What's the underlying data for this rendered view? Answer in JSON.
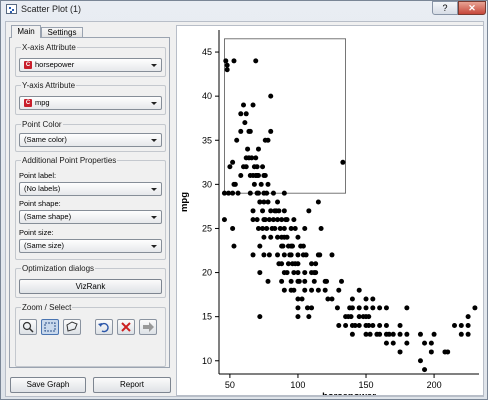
{
  "window": {
    "title": "Scatter Plot (1)",
    "help": "?",
    "close": "✕"
  },
  "tabs": [
    {
      "label": "Main"
    },
    {
      "label": "Settings"
    }
  ],
  "x_attr": {
    "label": "X-axis Attribute",
    "badge": "C",
    "value": "horsepower"
  },
  "y_attr": {
    "label": "Y-axis Attribute",
    "badge": "C",
    "value": "mpg"
  },
  "point_color": {
    "label": "Point Color",
    "value": "(Same color)"
  },
  "additional": {
    "label": "Additional Point Properties",
    "point_label": {
      "label": "Point label:",
      "value": "(No labels)"
    },
    "point_shape": {
      "label": "Point shape:",
      "value": "(Same shape)"
    },
    "point_size": {
      "label": "Point size:",
      "value": "(Same size)"
    }
  },
  "optimization": {
    "label": "Optimization dialogs",
    "button": "VizRank"
  },
  "zoom": {
    "label": "Zoom / Select"
  },
  "footer": {
    "save": "Save Graph",
    "report": "Report"
  },
  "chart_data": {
    "type": "scatter",
    "xlabel": "horsepower",
    "ylabel": "mpg",
    "xlim": [
      42,
      233
    ],
    "ylim": [
      8.5,
      47.5
    ],
    "xticks": [
      50,
      100,
      150,
      200
    ],
    "yticks": [
      10,
      15,
      20,
      25,
      30,
      35,
      40,
      45
    ],
    "grid": false,
    "selection_rect": {
      "x": [
        46,
        135
      ],
      "y": [
        29,
        46.5
      ]
    },
    "points": [
      [
        46,
        26
      ],
      [
        46,
        29
      ],
      [
        47,
        44
      ],
      [
        48,
        43.5
      ],
      [
        48,
        43
      ],
      [
        49,
        29
      ],
      [
        50,
        32
      ],
      [
        52,
        29
      ],
      [
        52,
        32.5
      ],
      [
        53,
        23
      ],
      [
        52,
        25
      ],
      [
        53,
        44
      ],
      [
        53,
        30
      ],
      [
        54,
        30
      ],
      [
        55,
        35
      ],
      [
        56,
        29
      ],
      [
        58,
        31
      ],
      [
        58,
        38
      ],
      [
        58,
        36
      ],
      [
        60,
        32
      ],
      [
        60,
        39
      ],
      [
        61,
        37
      ],
      [
        62,
        38
      ],
      [
        62,
        33
      ],
      [
        62,
        32
      ],
      [
        63,
        34
      ],
      [
        64,
        33
      ],
      [
        64,
        36
      ],
      [
        65,
        31
      ],
      [
        65,
        29
      ],
      [
        65,
        36
      ],
      [
        66,
        33
      ],
      [
        67,
        39
      ],
      [
        67,
        31
      ],
      [
        67,
        27
      ],
      [
        67,
        26
      ],
      [
        67,
        22
      ],
      [
        68,
        30
      ],
      [
        68,
        32
      ],
      [
        69,
        33
      ],
      [
        69,
        44
      ],
      [
        69,
        31
      ],
      [
        70,
        31
      ],
      [
        70,
        26
      ],
      [
        70,
        29
      ],
      [
        70,
        32
      ],
      [
        71,
        34
      ],
      [
        71,
        31
      ],
      [
        71,
        29
      ],
      [
        71,
        25
      ],
      [
        72,
        20
      ],
      [
        72,
        28
      ],
      [
        72,
        23
      ],
      [
        72,
        15
      ],
      [
        72,
        28
      ],
      [
        73,
        30
      ],
      [
        74,
        25
      ],
      [
        74,
        32
      ],
      [
        74,
        27
      ],
      [
        75,
        26
      ],
      [
        75,
        31
      ],
      [
        75,
        28
      ],
      [
        75,
        24
      ],
      [
        75,
        22
      ],
      [
        75,
        29
      ],
      [
        76,
        31
      ],
      [
        76,
        26
      ],
      [
        76,
        35
      ],
      [
        77,
        29
      ],
      [
        77,
        25
      ],
      [
        78,
        28
      ],
      [
        78,
        30
      ],
      [
        78,
        19
      ],
      [
        78,
        35
      ],
      [
        79,
        22
      ],
      [
        79,
        26
      ],
      [
        80,
        40
      ],
      [
        80,
        36
      ],
      [
        80,
        24
      ],
      [
        80,
        27
      ],
      [
        81,
        25
      ],
      [
        82,
        29
      ],
      [
        82,
        26
      ],
      [
        83,
        27
      ],
      [
        83,
        25
      ],
      [
        84,
        27
      ],
      [
        85,
        26
      ],
      [
        85,
        24
      ],
      [
        85,
        28
      ],
      [
        85,
        22
      ],
      [
        86,
        27
      ],
      [
        86,
        21
      ],
      [
        87,
        25
      ],
      [
        88,
        26
      ],
      [
        88,
        23
      ],
      [
        88,
        24
      ],
      [
        88,
        21
      ],
      [
        88,
        19
      ],
      [
        89,
        23
      ],
      [
        90,
        25
      ],
      [
        90,
        27
      ],
      [
        90,
        24
      ],
      [
        90,
        20
      ],
      [
        90,
        18
      ],
      [
        90,
        29
      ],
      [
        90,
        22
      ],
      [
        91,
        26
      ],
      [
        92,
        26
      ],
      [
        92,
        24
      ],
      [
        92,
        20
      ],
      [
        93,
        21
      ],
      [
        93,
        23
      ],
      [
        94,
        22
      ],
      [
        95,
        25
      ],
      [
        95,
        23
      ],
      [
        95,
        19
      ],
      [
        95,
        22
      ],
      [
        95,
        18
      ],
      [
        96,
        23
      ],
      [
        96,
        21
      ],
      [
        97,
        26
      ],
      [
        97,
        20
      ],
      [
        97,
        18
      ],
      [
        98,
        25
      ],
      [
        98,
        21
      ],
      [
        100,
        20
      ],
      [
        100,
        17
      ],
      [
        100,
        19
      ],
      [
        100,
        22
      ],
      [
        100,
        15
      ],
      [
        100,
        24
      ],
      [
        100,
        16
      ],
      [
        100,
        21
      ],
      [
        101,
        19
      ],
      [
        102,
        23
      ],
      [
        103,
        17
      ],
      [
        104,
        22
      ],
      [
        104,
        23
      ],
      [
        105,
        19
      ],
      [
        105,
        20
      ],
      [
        105,
        25
      ],
      [
        105,
        18
      ],
      [
        106,
        22
      ],
      [
        107,
        16
      ],
      [
        108,
        15
      ],
      [
        108,
        27
      ],
      [
        110,
        18
      ],
      [
        110,
        21
      ],
      [
        110,
        16
      ],
      [
        110,
        20
      ],
      [
        112,
        20
      ],
      [
        112,
        19
      ],
      [
        113,
        20
      ],
      [
        113,
        21
      ],
      [
        115,
        18
      ],
      [
        115,
        22
      ],
      [
        115,
        28
      ],
      [
        116,
        22
      ],
      [
        117,
        25
      ],
      [
        120,
        18
      ],
      [
        120,
        19
      ],
      [
        121,
        19
      ],
      [
        122,
        17
      ],
      [
        125,
        17
      ],
      [
        125,
        22
      ],
      [
        129,
        16
      ],
      [
        130,
        14
      ],
      [
        130,
        18
      ],
      [
        132,
        19
      ],
      [
        133,
        32.5
      ],
      [
        135,
        14
      ],
      [
        135,
        15
      ],
      [
        137,
        15
      ],
      [
        138,
        16
      ],
      [
        139,
        15
      ],
      [
        140,
        13
      ],
      [
        140,
        16
      ],
      [
        140,
        17
      ],
      [
        140,
        14
      ],
      [
        142,
        14
      ],
      [
        145,
        14
      ],
      [
        145,
        15
      ],
      [
        145,
        16
      ],
      [
        145,
        18
      ],
      [
        148,
        15
      ],
      [
        150,
        15
      ],
      [
        150,
        14
      ],
      [
        150,
        13
      ],
      [
        150,
        16
      ],
      [
        150,
        17
      ],
      [
        152,
        15
      ],
      [
        152,
        14
      ],
      [
        153,
        13
      ],
      [
        155,
        14
      ],
      [
        155,
        17
      ],
      [
        155,
        16
      ],
      [
        158,
        13
      ],
      [
        160,
        14
      ],
      [
        160,
        13
      ],
      [
        160,
        16
      ],
      [
        165,
        13
      ],
      [
        165,
        12
      ],
      [
        165,
        14
      ],
      [
        165,
        16
      ],
      [
        167,
        13
      ],
      [
        170,
        13
      ],
      [
        170,
        12
      ],
      [
        175,
        13
      ],
      [
        175,
        14
      ],
      [
        175,
        11
      ],
      [
        180,
        12
      ],
      [
        180,
        13
      ],
      [
        180,
        16
      ],
      [
        190,
        13
      ],
      [
        190,
        10
      ],
      [
        193,
        12
      ],
      [
        193,
        9
      ],
      [
        198,
        12
      ],
      [
        198,
        11
      ],
      [
        200,
        13
      ],
      [
        208,
        11
      ],
      [
        210,
        11
      ],
      [
        215,
        14
      ],
      [
        220,
        13
      ],
      [
        220,
        14
      ],
      [
        225,
        13
      ],
      [
        225,
        14
      ],
      [
        230,
        16
      ],
      [
        225,
        15
      ]
    ]
  }
}
